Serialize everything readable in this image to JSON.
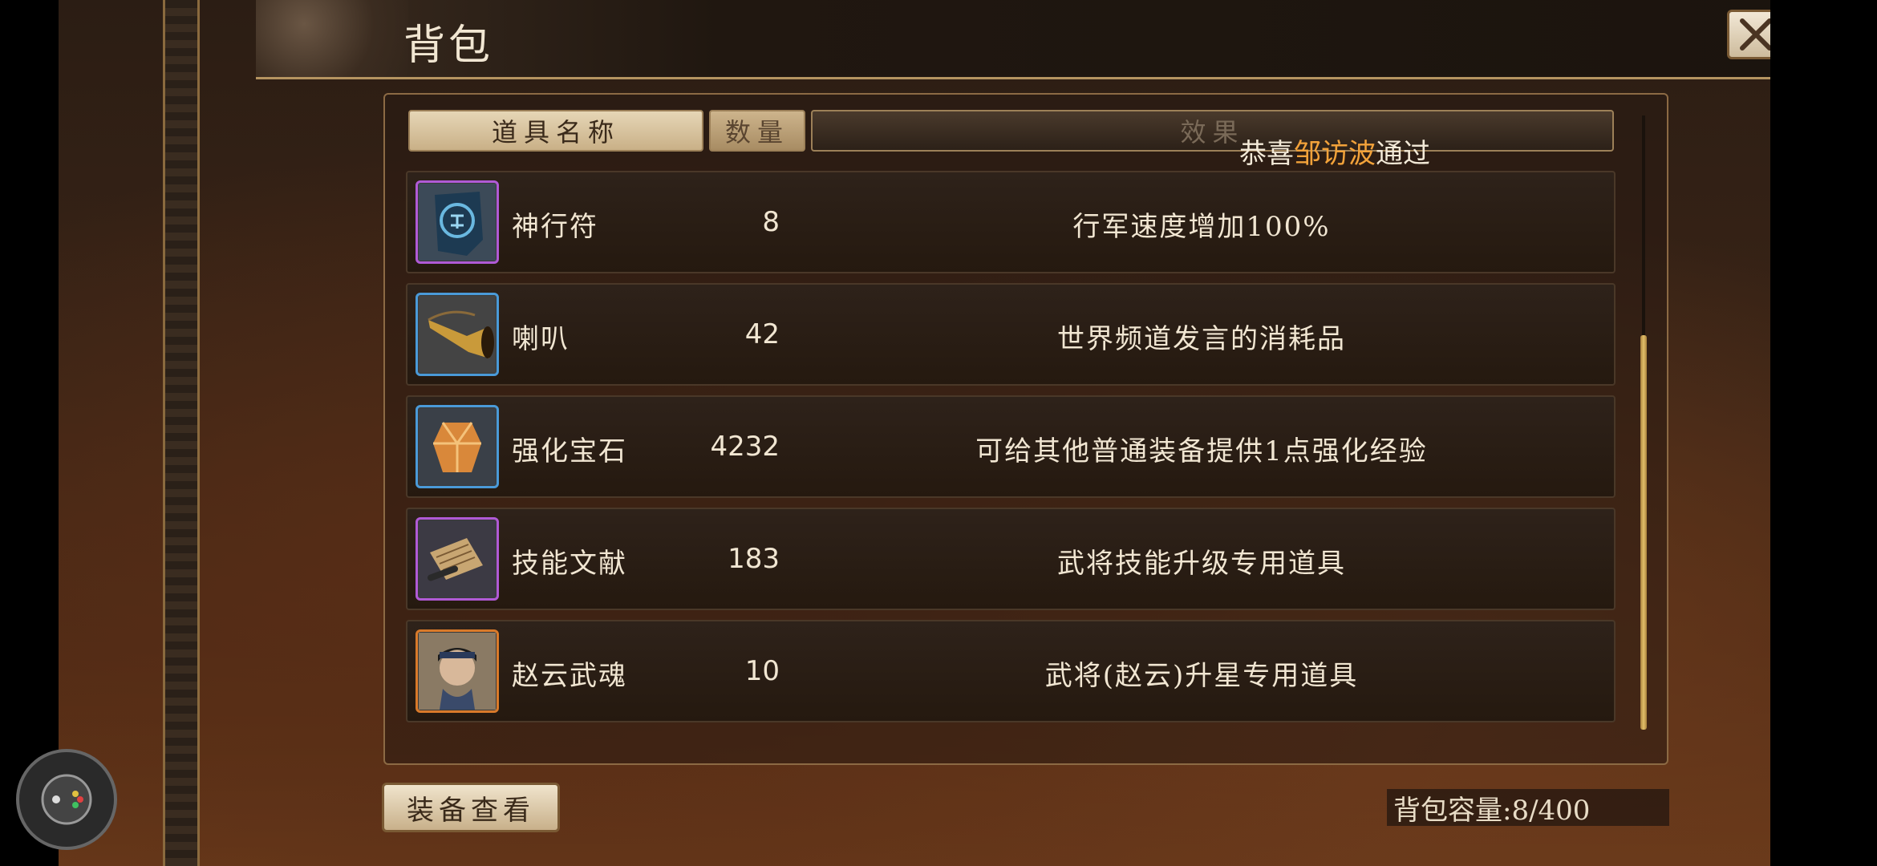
{
  "window": {
    "title": "背包"
  },
  "table": {
    "headers": {
      "name": "道具名称",
      "quantity": "数量",
      "effect": "效果"
    },
    "notice": {
      "prefix": "恭喜",
      "highlight": "邹访波",
      "suffix": "通过"
    },
    "items": [
      {
        "icon": "speed-talisman-icon",
        "name": "神行符",
        "quantity": "8",
        "effect": "行军速度增加100%",
        "rarity_color": "#b05ad6"
      },
      {
        "icon": "horn-icon",
        "name": "喇叭",
        "quantity": "42",
        "effect": "世界频道发言的消耗品",
        "rarity_color": "#4a9ad8"
      },
      {
        "icon": "gem-icon",
        "name": "强化宝石",
        "quantity": "4232",
        "effect": "可给其他普通装备提供1点强化经验",
        "rarity_color": "#4a9ad8"
      },
      {
        "icon": "scroll-icon",
        "name": "技能文献",
        "quantity": "183",
        "effect": "武将技能升级专用道具",
        "rarity_color": "#b05ad6"
      },
      {
        "icon": "hero-soul-icon",
        "name": "赵云武魂",
        "quantity": "10",
        "effect": "武将(赵云)升星专用道具",
        "rarity_color": "#d97a2a"
      }
    ]
  },
  "footer": {
    "equip_button": "装备查看",
    "capacity_label": "背包容量:8/400"
  },
  "scroll": {
    "position": 0.36
  }
}
